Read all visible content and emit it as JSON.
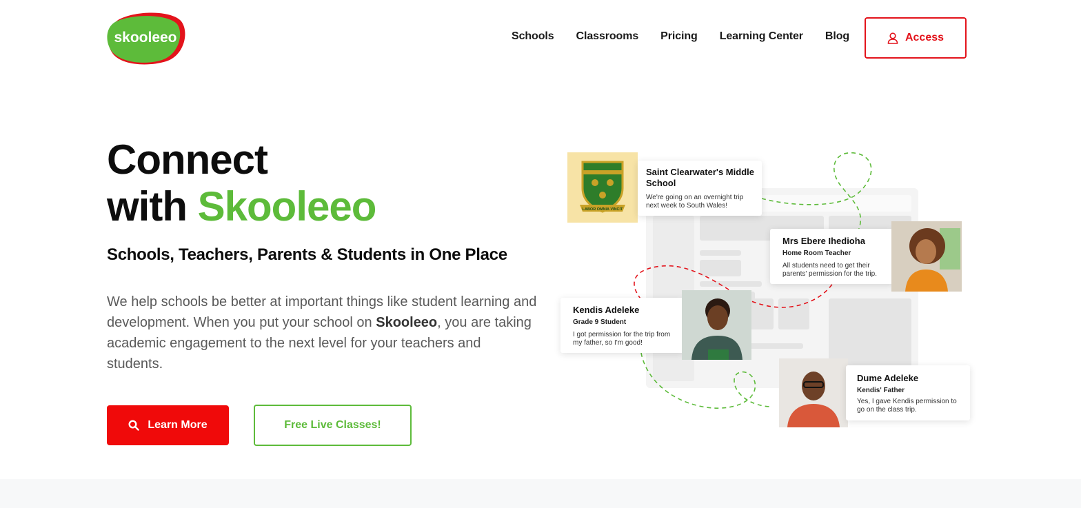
{
  "brand": {
    "logo_text": "skooleeo",
    "green": "#5dbb3a",
    "red": "#e3131b"
  },
  "nav": {
    "items": [
      "Schools",
      "Classrooms",
      "Pricing",
      "Learning Center",
      "Blog"
    ],
    "access_label": "Access",
    "access_icon": "user-icon"
  },
  "hero": {
    "title_line1": "Connect",
    "title_line2_prefix": "with ",
    "title_line2_brand": "Skooleeo",
    "subtitle": "Schools, Teachers, Parents & Students in One Place",
    "desc_part1": "We help schools be better at important things like student learning and development. When you put your school on ",
    "desc_brand": "Skooleeo",
    "desc_part2": ", you are taking academic engagement to the next level for your teachers and students.",
    "learn_more_label": "Learn More",
    "learn_more_icon": "search-icon",
    "free_classes_label": "Free Live Classes!"
  },
  "cards": {
    "school": {
      "name": "Saint Clearwater's Middle School",
      "msg": "We're going on an overnight trip next week to South Wales!",
      "crest_motto": "LABOR OMNIA VINCIT"
    },
    "teacher": {
      "name": "Mrs Ebere Ihedioha",
      "role": "Home Room Teacher",
      "msg": "All students need to get their parents' permission for the trip."
    },
    "student": {
      "name": "Kendis Adeleke",
      "role": "Grade 9 Student",
      "msg": "I got permission for the trip from my father, so I'm good!"
    },
    "parent": {
      "name": "Dume Adeleke",
      "role": "Kendis' Father",
      "msg": "Yes, I gave Kendis permission to go on the class trip."
    }
  }
}
